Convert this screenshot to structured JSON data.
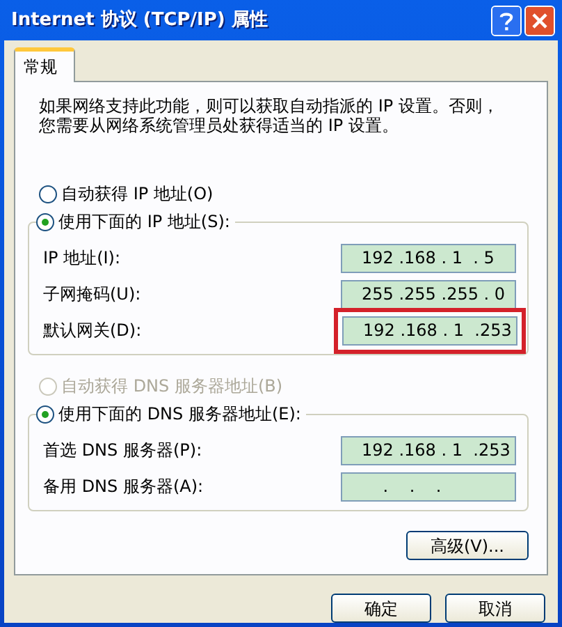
{
  "window": {
    "title": "Internet 协议 (TCP/IP) 属性"
  },
  "tabs": [
    {
      "label": "常规",
      "selected": true
    }
  ],
  "description_lines": [
    "如果网络支持此功能，则可以获取自动指派的 IP 设置。否则，",
    "您需要从网络系统管理员处获得适当的 IP 设置。"
  ],
  "sections": [
    {
      "auto_option": {
        "label": "自动获得 IP 地址(O)",
        "selected": false,
        "disabled": false
      },
      "manual_option": {
        "label": "使用下面的 IP 地址(S):",
        "selected": true,
        "disabled": false
      },
      "fields": [
        {
          "label": "IP 地址(I):",
          "value": "192 .168 . 1  . 5",
          "highlighted": false
        },
        {
          "label": "子网掩码(U):",
          "value": "255 .255 .255 . 0",
          "highlighted": false
        },
        {
          "label": "默认网关(D):",
          "value": "192 .168 . 1  .253",
          "highlighted": true
        }
      ]
    },
    {
      "auto_option": {
        "label": "自动获得 DNS 服务器地址(B)",
        "selected": false,
        "disabled": true
      },
      "manual_option": {
        "label": "使用下面的 DNS 服务器地址(E):",
        "selected": true,
        "disabled": false
      },
      "fields": [
        {
          "label": "首选 DNS 服务器(P):",
          "value": "192 .168 . 1  .253",
          "highlighted": false
        },
        {
          "label": "备用 DNS 服务器(A):",
          "value": "    .    .    .",
          "highlighted": false
        }
      ]
    }
  ],
  "advanced_button": "高级(V)...",
  "dialog_buttons": [
    "确定",
    "取消"
  ]
}
